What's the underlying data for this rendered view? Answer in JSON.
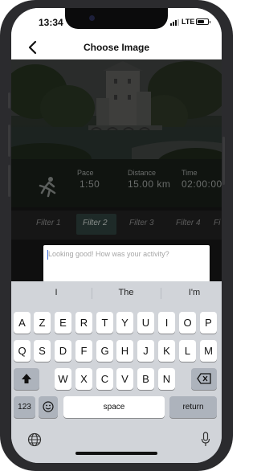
{
  "status_bar": {
    "time": "13:34",
    "network": "LTE"
  },
  "nav": {
    "title": "Choose Image"
  },
  "stats": {
    "pace_label": "Pace",
    "pace_value": "1:50",
    "distance_label": "Distance",
    "distance_value": "15.00 km",
    "time_label": "Time",
    "time_value": "02:00:00"
  },
  "filters": {
    "items": [
      "Filter 1",
      "Filter 2",
      "Filter 3",
      "Filter 4",
      "Fi"
    ],
    "selected": "Filter 2"
  },
  "caption": {
    "placeholder": "Looking good! How was your activity?"
  },
  "keyboard": {
    "suggestions": [
      "I",
      "The",
      "I'm"
    ],
    "row1": [
      "A",
      "Z",
      "E",
      "R",
      "T",
      "Y",
      "U",
      "I",
      "O",
      "P"
    ],
    "row2": [
      "Q",
      "S",
      "D",
      "F",
      "G",
      "H",
      "J",
      "K",
      "L",
      "M"
    ],
    "row3": [
      "W",
      "X",
      "C",
      "V",
      "B",
      "N"
    ],
    "numbers_label": "123",
    "space_label": "space",
    "return_label": "return"
  },
  "colors": {
    "accent_caret": "#3b6bd6",
    "selected_filter_bg": "#1e2a28"
  }
}
